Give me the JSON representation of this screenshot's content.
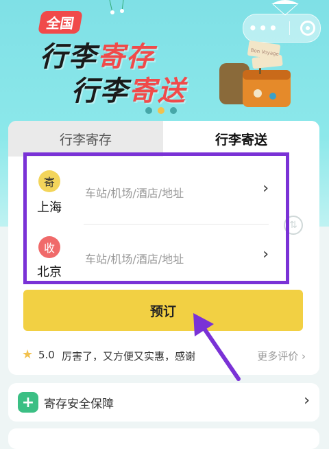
{
  "banner": {
    "badge": "全国",
    "line1_a": "行李",
    "line1_b": "寄存",
    "line2_a": "行李",
    "line2_b": "寄送",
    "luggage_sign": "Bon Voyage",
    "carousel_total": 3,
    "carousel_active": 2
  },
  "tabs": [
    {
      "label": "行李寄存"
    },
    {
      "label": "行李寄送"
    }
  ],
  "route": {
    "sender": {
      "tag": "寄",
      "city": "上海",
      "placeholder": "车站/机场/酒店/地址"
    },
    "receiver": {
      "tag": "收",
      "city": "北京",
      "placeholder": "车站/机场/酒店/地址"
    }
  },
  "book_button": "预订",
  "review": {
    "rating": "5.0",
    "text": "厉害了，又方便又实惠，感谢",
    "more": "更多评价"
  },
  "safety": {
    "label": "寄存安全保障"
  },
  "colors": {
    "banner": "#8ce8ea",
    "accent_red": "#f04a4a",
    "book_button": "#f2d043",
    "highlight": "#7a32d6",
    "shield": "#3bbf84"
  }
}
